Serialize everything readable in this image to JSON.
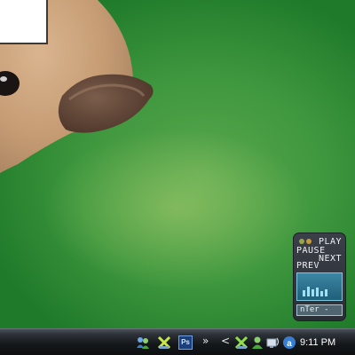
{
  "media_player": {
    "play_label": "PLAY",
    "pause_label": "PAUSE",
    "next_label": "NEXT",
    "prev_label": "PREV",
    "station_text": "nTer -",
    "eq_levels": [
      0.6,
      0.9,
      0.7,
      0.8,
      0.5,
      0.7
    ]
  },
  "taskbar": {
    "tray_icons": [
      "messenger-icon",
      "network-x-icon",
      "photoshop-icon",
      "network-x-icon",
      "buddy-icon",
      "network-icon",
      "antivirus-icon"
    ],
    "photoshop_label": "Ps",
    "chevron_label": "»",
    "collapse_label": "<",
    "clock": "9:11 PM"
  },
  "colors": {
    "desktop_green": "#3d963d",
    "taskbar": "#141719",
    "widget_panel": "#2a2e35",
    "widget_screen": "#1f5f79"
  }
}
